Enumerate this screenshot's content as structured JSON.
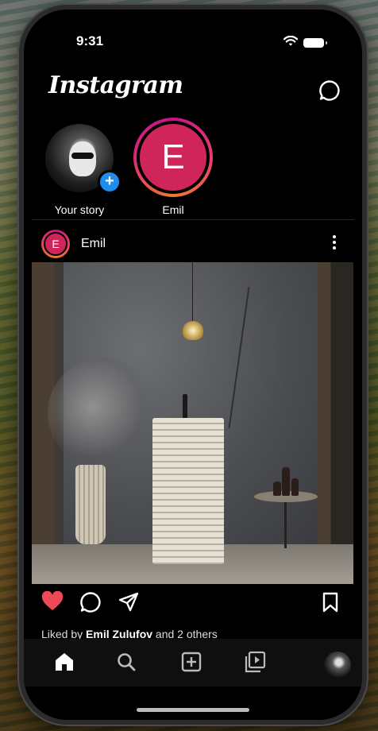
{
  "status": {
    "time": "9:31"
  },
  "header": {
    "logo": "Instagram",
    "icons": [
      "messenger-icon"
    ]
  },
  "stories": [
    {
      "label": "Your story",
      "badge": "+"
    },
    {
      "label": "Emil",
      "initial": "E"
    }
  ],
  "post": {
    "username": "Emil",
    "initial": "E",
    "liked_prefix": "Liked by ",
    "liked_user": "Emil Zulufov",
    "liked_suffix": " and 2 others",
    "actions": [
      "heart-icon",
      "comment-icon",
      "share-icon",
      "bookmark-icon"
    ]
  },
  "tabbar": {
    "items": [
      "home-icon",
      "search-icon",
      "add-icon",
      "reels-icon",
      "profile-avatar"
    ]
  },
  "colors": {
    "accent_blue": "#1d8df0",
    "avatar_pink": "#d0255a",
    "like_red": "#ed4956"
  }
}
